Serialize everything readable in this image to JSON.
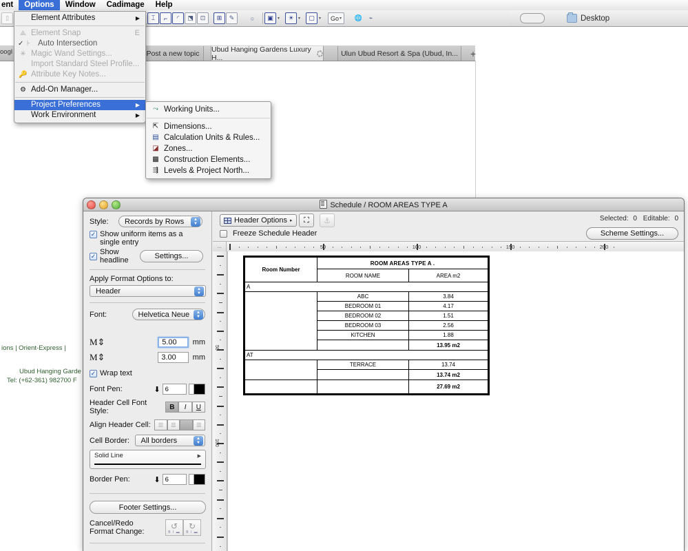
{
  "menubar": {
    "clipped_left": "ent",
    "items": [
      {
        "label": "Options",
        "selected": true
      },
      {
        "label": "Window",
        "selected": false
      },
      {
        "label": "Cadimage",
        "selected": false
      },
      {
        "label": "Help",
        "selected": false
      }
    ]
  },
  "toolbar": {
    "go_label": "Go",
    "desktop_label": "Desktop",
    "icons": [
      "cursor-icon",
      "marquee-icon",
      "line-icon",
      "polyline-icon",
      "arc-icon",
      "fill-icon",
      "hatch-icon",
      "zone-icon",
      "dimension-icon",
      "radial-dim-icon",
      "level-dim-icon",
      "angle-dim-icon",
      "text-icon",
      "label-icon",
      "object-icon",
      "lamp-icon",
      "morph-icon",
      "curtain-wall-icon",
      "stair-icon",
      "railing-icon",
      "mesh-icon",
      "roof-icon",
      "shell-icon",
      "window-icon",
      "door-icon",
      "skylight-icon",
      "globe-icon",
      "marker-icon"
    ]
  },
  "options_menu": {
    "items": [
      {
        "label": "Element Attributes",
        "icon": "",
        "state": "normal",
        "submenu": true,
        "shortcut": ""
      },
      {
        "label": "Element Snap",
        "icon": "snap-icon",
        "state": "disabled",
        "submenu": false,
        "shortcut": "E"
      },
      {
        "label": "Auto Intersection",
        "icon": "intersection-icon",
        "state": "checked",
        "submenu": false,
        "shortcut": ""
      },
      {
        "label": "Magic Wand Settings...",
        "icon": "wand-icon",
        "state": "disabled",
        "submenu": false,
        "shortcut": ""
      },
      {
        "label": "Import Standard Steel Profile...",
        "icon": "",
        "state": "disabled",
        "submenu": false,
        "shortcut": ""
      },
      {
        "label": "Attribute Key Notes...",
        "icon": "keynote-icon",
        "state": "disabled",
        "submenu": false,
        "shortcut": ""
      },
      {
        "label": "Add-On Manager...",
        "icon": "addon-icon",
        "state": "normal",
        "submenu": false,
        "shortcut": ""
      },
      {
        "label": "Project Preferences",
        "icon": "",
        "state": "highlighted",
        "submenu": true,
        "shortcut": ""
      },
      {
        "label": "Work Environment",
        "icon": "",
        "state": "normal",
        "submenu": true,
        "shortcut": ""
      }
    ]
  },
  "project_preferences_submenu": {
    "items": [
      {
        "label": "Working Units...",
        "icon": "working-units-icon"
      },
      {
        "label": "Dimensions...",
        "icon": "dimensions-icon"
      },
      {
        "label": "Calculation Units & Rules...",
        "icon": "calculation-icon"
      },
      {
        "label": "Zones...",
        "icon": "zones-icon"
      },
      {
        "label": "Construction Elements...",
        "icon": "construction-icon"
      },
      {
        "label": "Levels & Project North...",
        "icon": "levels-icon"
      }
    ]
  },
  "browser_tabs": {
    "tabs": [
      {
        "label": "Post a new topic",
        "active": false,
        "loading": false
      },
      {
        "label": "Ubud Hanging Gardens Luxury H...",
        "active": true,
        "loading": true
      },
      {
        "label": "Ulun Ubud Resort & Spa (Ubud, In...",
        "active": false,
        "loading": false
      }
    ],
    "new_tab_label": "+",
    "clipped_left_label": "oogl"
  },
  "page_snippets": {
    "line1": "ions  |   Orient-Express   |",
    "line2": "Ubud Hanging Garde",
    "line3": "Tel: (+62-361) 982700 F"
  },
  "schedule_window": {
    "title": "Schedule /  ROOM AREAS TYPE A",
    "title_icon": "schedule-icon",
    "left_panel": {
      "style_label": "Style:",
      "style_value": "Records by Rows",
      "show_uniform_label": "Show uniform items as a single entry",
      "show_uniform_checked": true,
      "show_headline_label": "Show headline",
      "show_headline_checked": true,
      "settings_button": "Settings...",
      "apply_format_label": "Apply Format Options to:",
      "apply_format_value": "Header",
      "font_label": "Font:",
      "font_value": "Helvetica Neue",
      "size_major_value": "5.00",
      "size_major_unit": "mm",
      "size_minor_value": "3.00",
      "size_minor_unit": "mm",
      "wrap_text_label": "Wrap text",
      "wrap_text_checked": true,
      "font_pen_label": "Font Pen:",
      "font_pen_value": "6",
      "header_cell_font_style_label": "Header Cell Font Style:",
      "font_style_bold": "B",
      "font_style_italic": "I",
      "font_style_underline": "U",
      "align_header_cell_label": "Align Header Cell:",
      "cell_border_label": "Cell Border:",
      "cell_border_value": "All borders",
      "line_type_value": "Solid Line",
      "border_pen_label": "Border Pen:",
      "border_pen_value": "6",
      "footer_settings_button": "Footer Settings...",
      "cancel_redo_label_1": "Cancel/Redo",
      "cancel_redo_label_2": "Format Change:"
    },
    "right_panel": {
      "header_options_button": "Header Options",
      "freeze_header_label": "Freeze Schedule Header",
      "freeze_header_checked": false,
      "selected_label": "Selected:",
      "selected_value": "0",
      "editable_label": "Editable:",
      "editable_value": "0",
      "scheme_settings_button": "Scheme Settings...",
      "h_ruler_ticks": [
        "50",
        "100",
        "150",
        "200"
      ],
      "v_ruler_ticks": [
        "50",
        "100"
      ],
      "ruler_corner_label": "..."
    }
  },
  "chart_data": {
    "type": "table",
    "title": "ROOM AREAS TYPE A",
    "title_suffix": ".",
    "columns": [
      "Room Number",
      "ROOM NAME",
      "AREA m2"
    ],
    "groups": [
      {
        "group_label": "A",
        "rows": [
          {
            "name": "ABC",
            "area": "3.84"
          },
          {
            "name": "BEDROOM 01",
            "area": "4.17"
          },
          {
            "name": "BEDROOM 02",
            "area": "1.51"
          },
          {
            "name": "BEDROOM 03",
            "area": "2.56"
          },
          {
            "name": "KITCHEN",
            "area": "1.88"
          }
        ],
        "subtotal": "13.95 m2"
      },
      {
        "group_label": "AT",
        "rows": [
          {
            "name": "TERRACE",
            "area": "13.74"
          }
        ],
        "subtotal": "13.74 m2"
      }
    ],
    "total": "27.69 m2"
  }
}
